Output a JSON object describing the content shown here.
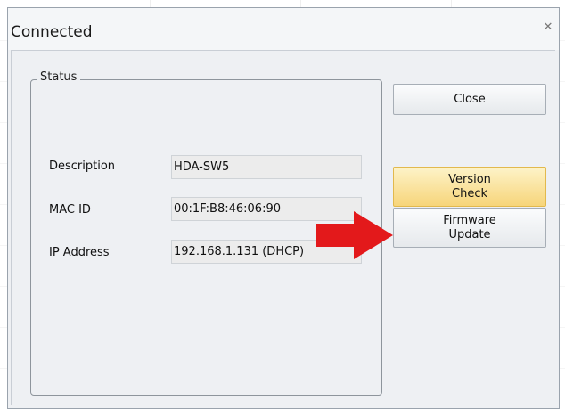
{
  "dialog": {
    "title": "Connected"
  },
  "status_group": {
    "label": "Status",
    "fields": [
      {
        "label": "Description",
        "value": "HDA-SW5"
      },
      {
        "label": "MAC ID",
        "value": "00:1F:B8:46:06:90"
      },
      {
        "label": "IP Address",
        "value": "192.168.1.131 (DHCP)"
      }
    ]
  },
  "buttons": {
    "close": "Close",
    "version_check_line1": "Version",
    "version_check_line2": "Check",
    "firmware_update_line1": "Firmware",
    "firmware_update_line2": "Update"
  },
  "colors": {
    "highlight_button": "#f7d57a",
    "arrow": "#e3191b"
  },
  "icons": {
    "title_close": "close-icon",
    "pointer": "red-arrow-icon"
  }
}
